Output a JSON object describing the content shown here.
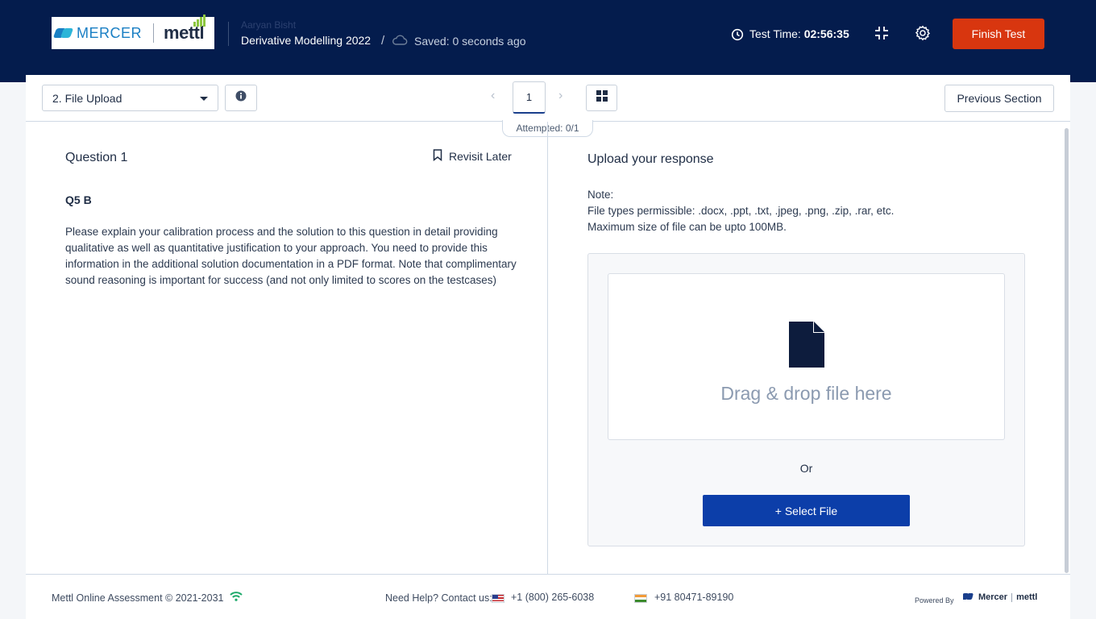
{
  "header": {
    "brand_mercer": "MERCER",
    "brand_mettl": "mettl",
    "candidate_name": "Aaryan Bisht",
    "test_title": "Derivative Modelling 2022",
    "separator": "/",
    "save_status": "Saved: 0 seconds ago",
    "timer_label": "Test Time:",
    "timer_value": "02:56:35",
    "finish_button": "Finish Test",
    "colors": {
      "bar": "#041c4d",
      "finish": "#d8360f"
    }
  },
  "toolbar": {
    "section_selected": "2. File Upload",
    "prev_arrow": "‹",
    "current_question": "1",
    "next_arrow": "›",
    "previous_section_button": "Previous Section",
    "attempted": "Attempted: 0/1"
  },
  "question": {
    "title": "Question 1",
    "revisit_label": "Revisit Later",
    "code": "Q5 B",
    "text": "Please explain your calibration process and the solution to this question in detail providing qualitative as well as quantitative justification to your approach. You need to provide this information in the additional solution documentation in a PDF format. Note that complimentary sound reasoning is important for success (and not only limited to scores on the testcases)"
  },
  "upload": {
    "title": "Upload your response",
    "note_label": "Note:",
    "file_types": "File types permissible: .docx, .ppt, .txt, .jpeg, .png, .zip, .rar, etc.",
    "max_size": "Maximum size of file can be upto 100MB.",
    "drop_text": "Drag & drop file here",
    "or_text": "Or",
    "select_button": "+ Select File",
    "colors": {
      "button": "#0c3ea9"
    }
  },
  "footer": {
    "copyright": "Mettl Online Assessment © 2021-2031",
    "help_label": "Need Help? Contact us:",
    "phone_us": "+1 (800) 265-6038",
    "phone_in": "+91 80471-89190",
    "powered_by": "Powered By",
    "logo_mercer": "Mercer",
    "logo_mettl": "mettl"
  },
  "icons": [
    "cloud-icon",
    "clock-icon",
    "compress-icon",
    "gear-icon",
    "info-icon",
    "grid-icon",
    "bookmark-icon",
    "file-icon",
    "wifi-icon",
    "us-flag-icon",
    "india-flag-icon"
  ]
}
